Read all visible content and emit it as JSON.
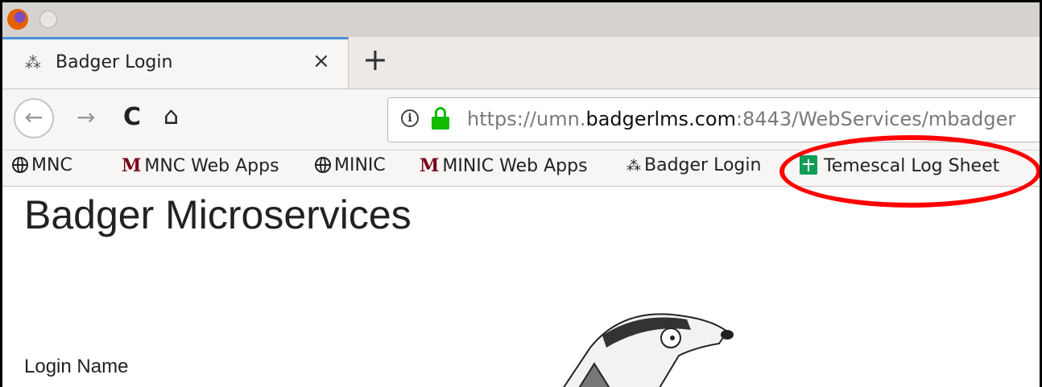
{
  "tabs": [
    {
      "title": "Badger Login",
      "icon": "badger-icon",
      "close": "×"
    }
  ],
  "new_tab": "+",
  "nav": {
    "back": "←",
    "forward": "→",
    "reload": "C",
    "home": "⌂"
  },
  "url": {
    "prefix": "https://umn.",
    "domain": "badgerlms.com",
    "suffix": ":8443/WebServices/mbadger",
    "info": "i"
  },
  "bookmarks": [
    {
      "label": "MNC",
      "icon": "globe-icon"
    },
    {
      "label": "MNC Web Apps",
      "icon": "umn-m-icon",
      "glyph": "M"
    },
    {
      "label": "MINIC",
      "icon": "globe-icon"
    },
    {
      "label": "MINIC Web Apps",
      "icon": "umn-m-icon",
      "glyph": "M"
    },
    {
      "label": "Badger Login",
      "icon": "badger-icon"
    },
    {
      "label": "Temescal Log Sheet",
      "icon": "google-sheets-icon"
    }
  ],
  "page": {
    "title": "Badger Microservices",
    "login_label": "Login Name"
  },
  "colors": {
    "highlight_ring": "#ff0000",
    "lock": "#12bc00",
    "umn_maroon": "#7a0019",
    "sheets_green": "#0f9d58"
  }
}
